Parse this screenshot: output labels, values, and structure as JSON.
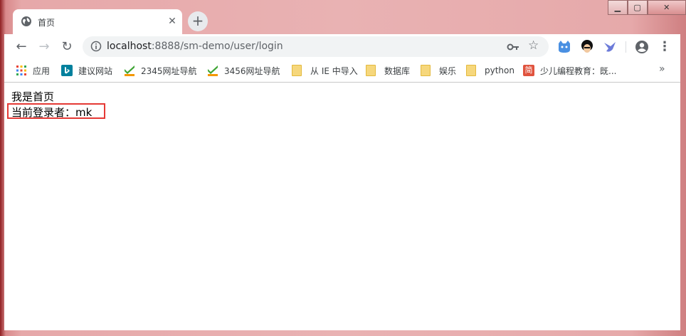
{
  "tab": {
    "title": "首页",
    "close": "✕"
  },
  "newtab": "+",
  "window_controls": {
    "min": "▁",
    "max": "▢",
    "close": "✕"
  },
  "toolbar": {
    "back": "←",
    "forward": "→",
    "reload": "↻",
    "url_host": "localhost",
    "url_path": ":8888/sm-demo/user/login",
    "bookmark_star": "☆",
    "menu": "⋮"
  },
  "bookmarks": [
    {
      "label": "应用",
      "icon": "apps-grid-icon"
    },
    {
      "label": "建议网站",
      "icon": "bing-icon"
    },
    {
      "label": "2345网址导航",
      "icon": "hao-icon"
    },
    {
      "label": "3456网址导航",
      "icon": "hao-icon"
    },
    {
      "label": "从 IE 中导入",
      "icon": "folder-icon"
    },
    {
      "label": "数据库",
      "icon": "folder-icon"
    },
    {
      "label": "娱乐",
      "icon": "folder-icon"
    },
    {
      "label": "python",
      "icon": "folder-icon"
    },
    {
      "label": "少儿编程教育：既...",
      "icon": "jian-icon",
      "icon_text": "简"
    }
  ],
  "bookmarks_more": "»",
  "page": {
    "line1": "我是首页",
    "line2": "当前登录者：mk"
  },
  "colors": {
    "highlight_border": "#e53935",
    "bing": "#00809d",
    "hao_check": "#3fa535",
    "hao_text": "#f39800",
    "jian": "#e0533e"
  }
}
